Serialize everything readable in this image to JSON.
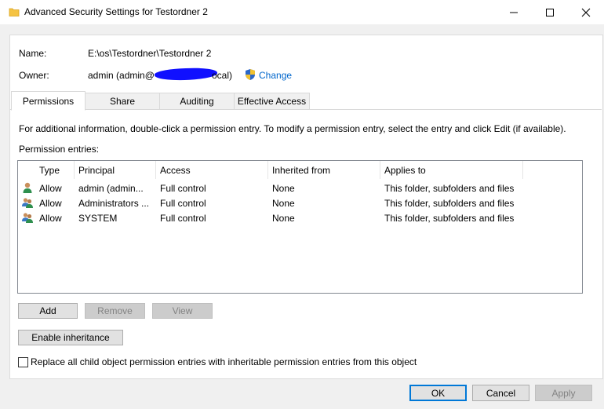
{
  "window": {
    "title": "Advanced Security Settings for Testordner 2",
    "icon": "folder-icon",
    "controls": [
      "minimize-icon",
      "maximize-icon",
      "close-icon"
    ]
  },
  "info": {
    "name_label": "Name:",
    "name_value": "E:\\os\\Testordner\\Testordner 2",
    "owner_label": "Owner:",
    "owner_value_start": "admin (admin@",
    "owner_value_end": "ocal)",
    "change_link": "Change",
    "change_icon": "uac-shield-icon"
  },
  "tabs": [
    {
      "label": "Permissions",
      "active": true
    },
    {
      "label": "Share",
      "active": false
    },
    {
      "label": "Auditing",
      "active": false
    },
    {
      "label": "Effective Access",
      "active": false
    }
  ],
  "permissions": {
    "instructions": "For additional information, double-click a permission entry. To modify a permission entry, select the entry and click Edit (if available).",
    "entries_label": "Permission entries:",
    "columns": [
      "Type",
      "Principal",
      "Access",
      "Inherited from",
      "Applies to"
    ],
    "rows": [
      {
        "icon": "user-icon",
        "type": "Allow",
        "principal": "admin (admin...",
        "access": "Full control",
        "inherited": "None",
        "applies": "This folder, subfolders and files"
      },
      {
        "icon": "group-icon",
        "type": "Allow",
        "principal": "Administrators ...",
        "access": "Full control",
        "inherited": "None",
        "applies": "This folder, subfolders and files"
      },
      {
        "icon": "group-icon",
        "type": "Allow",
        "principal": "SYSTEM",
        "access": "Full control",
        "inherited": "None",
        "applies": "This folder, subfolders and files"
      }
    ],
    "add_button": "Add",
    "remove_button": "Remove",
    "view_button": "View",
    "enable_inheritance_button": "Enable inheritance",
    "replace_checkbox_label": "Replace all child object permission entries with inheritable permission entries from this object",
    "replace_checked": false
  },
  "footer": {
    "ok": "OK",
    "cancel": "Cancel",
    "apply": "Apply"
  },
  "colors": {
    "link": "#0066cc",
    "default_button_border": "#0078d7",
    "redaction": "#1010ff"
  }
}
